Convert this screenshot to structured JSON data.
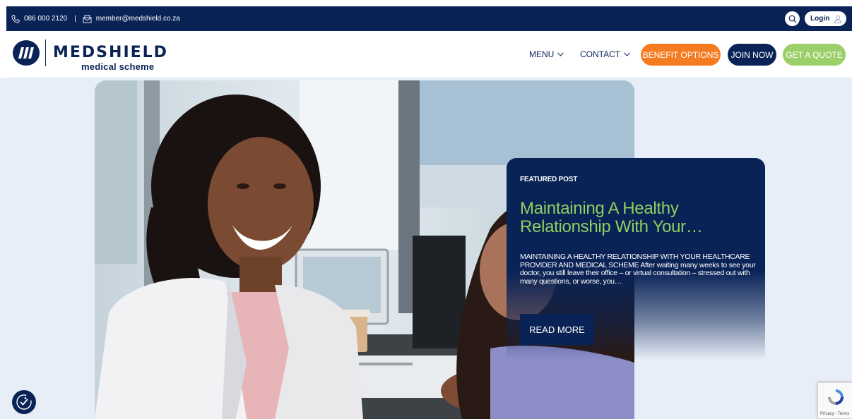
{
  "topbar": {
    "phone": "086 000 2120",
    "separator": "|",
    "email": "member@medshield.co.za",
    "login_label": "Login",
    "icons": [
      "phone-icon",
      "email-icon",
      "search-icon",
      "user-icon"
    ]
  },
  "header": {
    "brand_name": "MEDSHIELD",
    "brand_sub": "medical scheme",
    "nav": [
      {
        "label": "MENU"
      },
      {
        "label": "CONTACT"
      }
    ],
    "buttons": {
      "benefit": "BENEFIT OPTIONS",
      "join": "JOIN NOW",
      "quote": "GET A QUOTE"
    }
  },
  "featured": {
    "label": "FEATURED POST",
    "title": "Maintaining A Healthy Relationship With Your…",
    "excerpt": "MAINTAINING A HEALTHY RELATIONSHIP WITH YOUR HEALTHCARE PROVIDER AND MEDICAL SCHEME After waiting many weeks to see your doctor, you still leave their office – or virtual consultation – stressed out with many questions, or worse, you…",
    "read_more": "READ MORE"
  },
  "recaptcha": {
    "terms": "Privacy - Terms"
  },
  "colors": {
    "navy": "#0a2357",
    "orange": "#f47b20",
    "green": "#9bcf6a",
    "title_green": "#8fcf5f",
    "hero_bg": "#e8eef8"
  }
}
